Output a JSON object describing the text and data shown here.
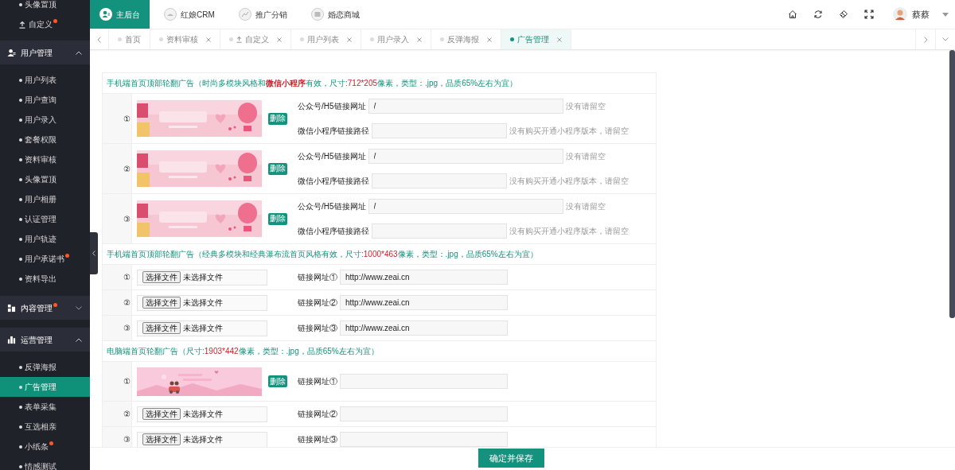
{
  "sidebar": {
    "items": [
      {
        "kind": "item",
        "label": "头像置顶",
        "badge": false,
        "selected": false
      },
      {
        "kind": "upload-item",
        "label": "自定义",
        "badge": true,
        "selected": false
      },
      {
        "kind": "group",
        "label": "用户管理",
        "badge": false,
        "expanded": true,
        "children": [
          {
            "label": "用户列表",
            "badge": false,
            "selected": false
          },
          {
            "label": "用户查询",
            "badge": false,
            "selected": false
          },
          {
            "label": "用户录入",
            "badge": false,
            "selected": false
          },
          {
            "label": "套餐权限",
            "badge": false,
            "selected": false
          },
          {
            "label": "资料审核",
            "badge": false,
            "selected": false
          },
          {
            "label": "头像置顶",
            "badge": false,
            "selected": false
          },
          {
            "label": "用户相册",
            "badge": false,
            "selected": false
          },
          {
            "label": "认证管理",
            "badge": false,
            "selected": false
          },
          {
            "label": "用户轨迹",
            "badge": false,
            "selected": false
          },
          {
            "label": "用户承诺书",
            "badge": true,
            "selected": false
          },
          {
            "label": "资料导出",
            "badge": false,
            "selected": false
          }
        ]
      },
      {
        "kind": "group",
        "label": "内容管理",
        "badge": true,
        "expanded": false
      },
      {
        "kind": "group",
        "label": "运营管理",
        "badge": false,
        "expanded": true,
        "children": [
          {
            "label": "反弹海报",
            "badge": false,
            "selected": false
          },
          {
            "label": "广告管理",
            "badge": false,
            "selected": true
          },
          {
            "label": "表单采集",
            "badge": false,
            "selected": false
          },
          {
            "label": "互选相亲",
            "badge": false,
            "selected": false
          },
          {
            "label": "小纸条",
            "badge": true,
            "selected": false
          },
          {
            "label": "情感测试",
            "badge": false,
            "selected": false
          }
        ]
      }
    ]
  },
  "modules": [
    {
      "label": "主后台",
      "selected": true
    },
    {
      "label": "红娘CRM",
      "selected": false
    },
    {
      "label": "推广分销",
      "selected": false
    },
    {
      "label": "婚恋商城",
      "selected": false
    }
  ],
  "user": {
    "name": "蔡蔡"
  },
  "tabs": [
    {
      "kind": "plain",
      "label": "首页",
      "closable": false,
      "selected": false
    },
    {
      "kind": "plain",
      "label": "资料审核",
      "closable": true,
      "selected": false
    },
    {
      "kind": "upload",
      "label": "自定义",
      "closable": true,
      "selected": false
    },
    {
      "kind": "plain",
      "label": "用户列表",
      "closable": true,
      "selected": false
    },
    {
      "kind": "plain",
      "label": "用户录入",
      "closable": true,
      "selected": false
    },
    {
      "kind": "plain",
      "label": "反弹海报",
      "closable": true,
      "selected": false
    },
    {
      "kind": "plain",
      "label": "广告管理",
      "closable": true,
      "selected": true
    }
  ],
  "sections": [
    {
      "title": [
        {
          "text": "手机端首页顶部轮翻广告（时尚多模块风格和",
          "highlight": false
        },
        {
          "text": "**微信小程序**",
          "highlight": true
        },
        {
          "text": "有效，尺寸:",
          "highlight": false
        },
        {
          "text": "712*205",
          "highlight": true
        },
        {
          "text": "像素，类型：.jpg，品质65%左右为宜）",
          "highlight": false
        }
      ],
      "rows": [
        {
          "index": "①",
          "delete_label": "删除",
          "links": [
            {
              "label": "公众号/H5链接网址",
              "value": "/",
              "hint": "没有请留空"
            },
            {
              "label": "微信小程序链接路径",
              "hint": "没有购买开通小程序版本，请留空"
            }
          ]
        },
        {
          "index": "②",
          "delete_label": "删除",
          "links": [
            {
              "label": "公众号/H5链接网址",
              "value": "/",
              "hint": "没有请留空"
            },
            {
              "label": "微信小程序链接路径",
              "hint": "没有购买开通小程序版本，请留空"
            }
          ]
        },
        {
          "index": "③",
          "delete_label": "删除",
          "links": [
            {
              "label": "公众号/H5链接网址",
              "value": "/",
              "hint": "没有请留空"
            },
            {
              "label": "微信小程序链接路径",
              "hint": "没有购买开通小程序版本，请留空"
            }
          ]
        }
      ]
    },
    {
      "title": [
        {
          "text": "手机端首页顶部轮翻广告（经典多模块和经典瀑布流首页风格有效，尺寸:",
          "highlight": false
        },
        {
          "text": "1000*463",
          "highlight": true
        },
        {
          "text": "像素，类型：.jpg，品质65%左右为宜）",
          "highlight": false
        }
      ],
      "rows": [
        {
          "kind": "file",
          "index": "①",
          "file_button": "选择文件",
          "file_status": "未选择文件",
          "links": [
            {
              "label": "链接网址①",
              "value": "http://www.zeai.cn"
            }
          ]
        },
        {
          "kind": "file",
          "index": "②",
          "file_button": "选择文件",
          "file_status": "未选择文件",
          "links": [
            {
              "label": "链接网址②",
              "value": "http://www.zeai.cn"
            }
          ]
        },
        {
          "kind": "file",
          "index": "③",
          "file_button": "选择文件",
          "file_status": "未选择文件",
          "links": [
            {
              "label": "链接网址③",
              "value": "http://www.zeai.cn"
            }
          ]
        }
      ]
    },
    {
      "title": [
        {
          "text": "电脑端首页轮翻广告（尺寸:",
          "highlight": false
        },
        {
          "text": "1903*442",
          "highlight": true
        },
        {
          "text": "像素，类型：.jpg，品质65%左右为宜）",
          "highlight": false
        }
      ],
      "rows": [
        {
          "index": "①",
          "delete_label": "删除",
          "links": [
            {
              "label": "链接网址①"
            }
          ]
        },
        {
          "kind": "file",
          "index": "②",
          "file_button": "选择文件",
          "file_status": "未选择文件",
          "links": [
            {
              "label": "链接网址②"
            }
          ]
        },
        {
          "kind": "file",
          "index": "③",
          "file_button": "选择文件",
          "file_status": "未选择文件",
          "links": [
            {
              "label": "链接网址③"
            }
          ]
        }
      ]
    }
  ],
  "save_button": "确定并保存"
}
